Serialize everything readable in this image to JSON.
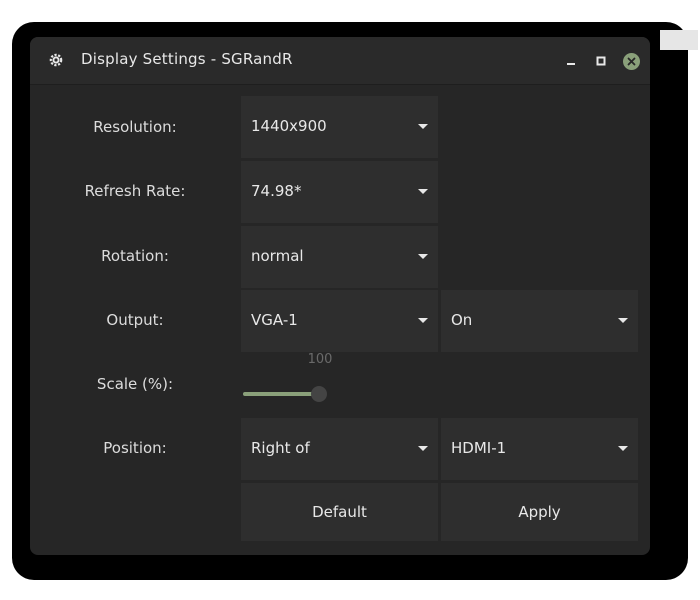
{
  "window": {
    "title": "Display Settings - SGRandR"
  },
  "labels": {
    "resolution": "Resolution:",
    "refresh_rate": "Refresh Rate:",
    "rotation": "Rotation:",
    "output": "Output:",
    "scale": "Scale (%):",
    "position": "Position:"
  },
  "fields": {
    "resolution": "1440x900",
    "refresh_rate": "74.98*",
    "rotation": "normal",
    "output": "VGA-1",
    "output_state": "On",
    "position_relation": "Right of",
    "position_target": "HDMI-1"
  },
  "scale": {
    "value_label": "100",
    "value": 100
  },
  "buttons": {
    "default": "Default",
    "apply": "Apply"
  },
  "colors": {
    "accent": "#8aa07a",
    "window_bg": "#262626",
    "field_bg": "#2e2e2e"
  },
  "icons": {
    "app": "settings-gear-icon",
    "minimize": "minimize-icon",
    "maximize": "maximize-icon",
    "close": "close-icon"
  }
}
